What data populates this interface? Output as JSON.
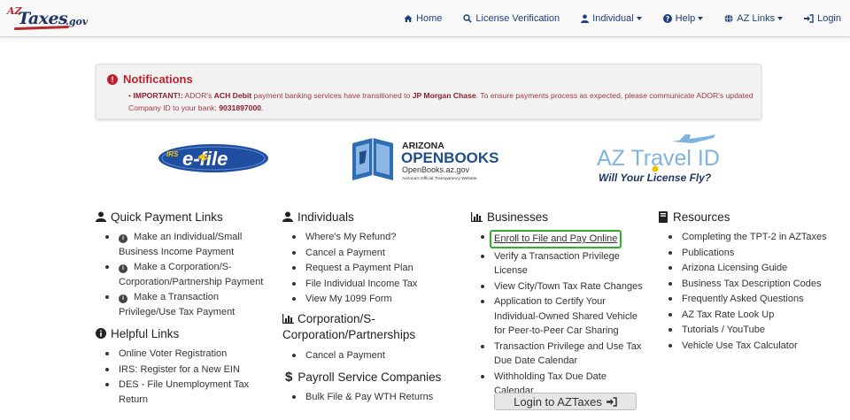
{
  "logo": {
    "az": "AZ",
    "taxes": "Taxes",
    "gov": ".gov"
  },
  "nav": {
    "home": "Home",
    "license": "License Verification",
    "individual": "Individual",
    "help": "Help",
    "azlinks": "AZ Links",
    "login": "Login"
  },
  "notification": {
    "title": "Notifications",
    "important": "IMPORTANT!:",
    "text1": " ADOR's ",
    "ach": "ACH Debit",
    "text2": " payment banking services have transitioned to ",
    "jpm": "JP Morgan Chase",
    "text3": ". To ensure payments process as expected, please communicate ADOR's updated Company ID to your bank: ",
    "company_id": "9031897000",
    "end": "."
  },
  "logos": {
    "efile_irs": "IRS",
    "efile_text": "e-file",
    "openbooks_az": "ARIZONA",
    "openbooks_name": "OPENBOOKS",
    "openbooks_url": "OpenBooks.az.gov",
    "openbooks_tag": "Arizona's Official Transparency Website",
    "travel_title": "AZ Travel ID",
    "travel_sub": "Will Your License Fly?"
  },
  "quick": {
    "heading": "Quick Payment Links",
    "items": [
      "Make an Individual/Small Business Income Payment",
      "Make a Corporation/S-Corporation/Partnership Payment",
      "Make a Transaction Privilege/Use Tax Payment"
    ]
  },
  "helpful": {
    "heading": "Helpful Links",
    "items": [
      "Online Voter Registration",
      "IRS: Register for a New EIN",
      "DES - File Unemployment Tax Return"
    ]
  },
  "individuals": {
    "heading": "Individuals",
    "items": [
      "Where's My Refund?",
      "Cancel a Payment",
      "Request a Payment Plan",
      "File Individual Income Tax",
      "View My 1099 Form"
    ]
  },
  "corp": {
    "heading": "Corporation/S-Corporation/Partnerships",
    "items": [
      "Cancel a Payment"
    ]
  },
  "payroll": {
    "heading": "Payroll Service Companies",
    "items": [
      "Bulk File & Pay WTH Returns"
    ]
  },
  "businesses": {
    "heading": "Businesses",
    "items": [
      "Enroll to File and Pay Online",
      "Verify a Transaction Privilege License",
      "View City/Town Tax Rate Changes",
      "Application to Certify Your Individual-Owned Shared Vehicle for Peer-to-Peer Car Sharing",
      "Transaction Privilege and Use Tax Due Date Calendar",
      "Withholding Tax Due Date Calendar"
    ],
    "login_button": "Login to AZTaxes"
  },
  "resources": {
    "heading": "Resources",
    "items": [
      "Completing the TPT-2 in AZTaxes",
      "Publications",
      "Arizona Licensing Guide",
      "Business Tax Description Codes",
      "Frequently Asked Questions",
      "AZ Tax Rate Look Up",
      "Tutorials / YouTube",
      "Vehicle Use Tax Calculator"
    ]
  }
}
